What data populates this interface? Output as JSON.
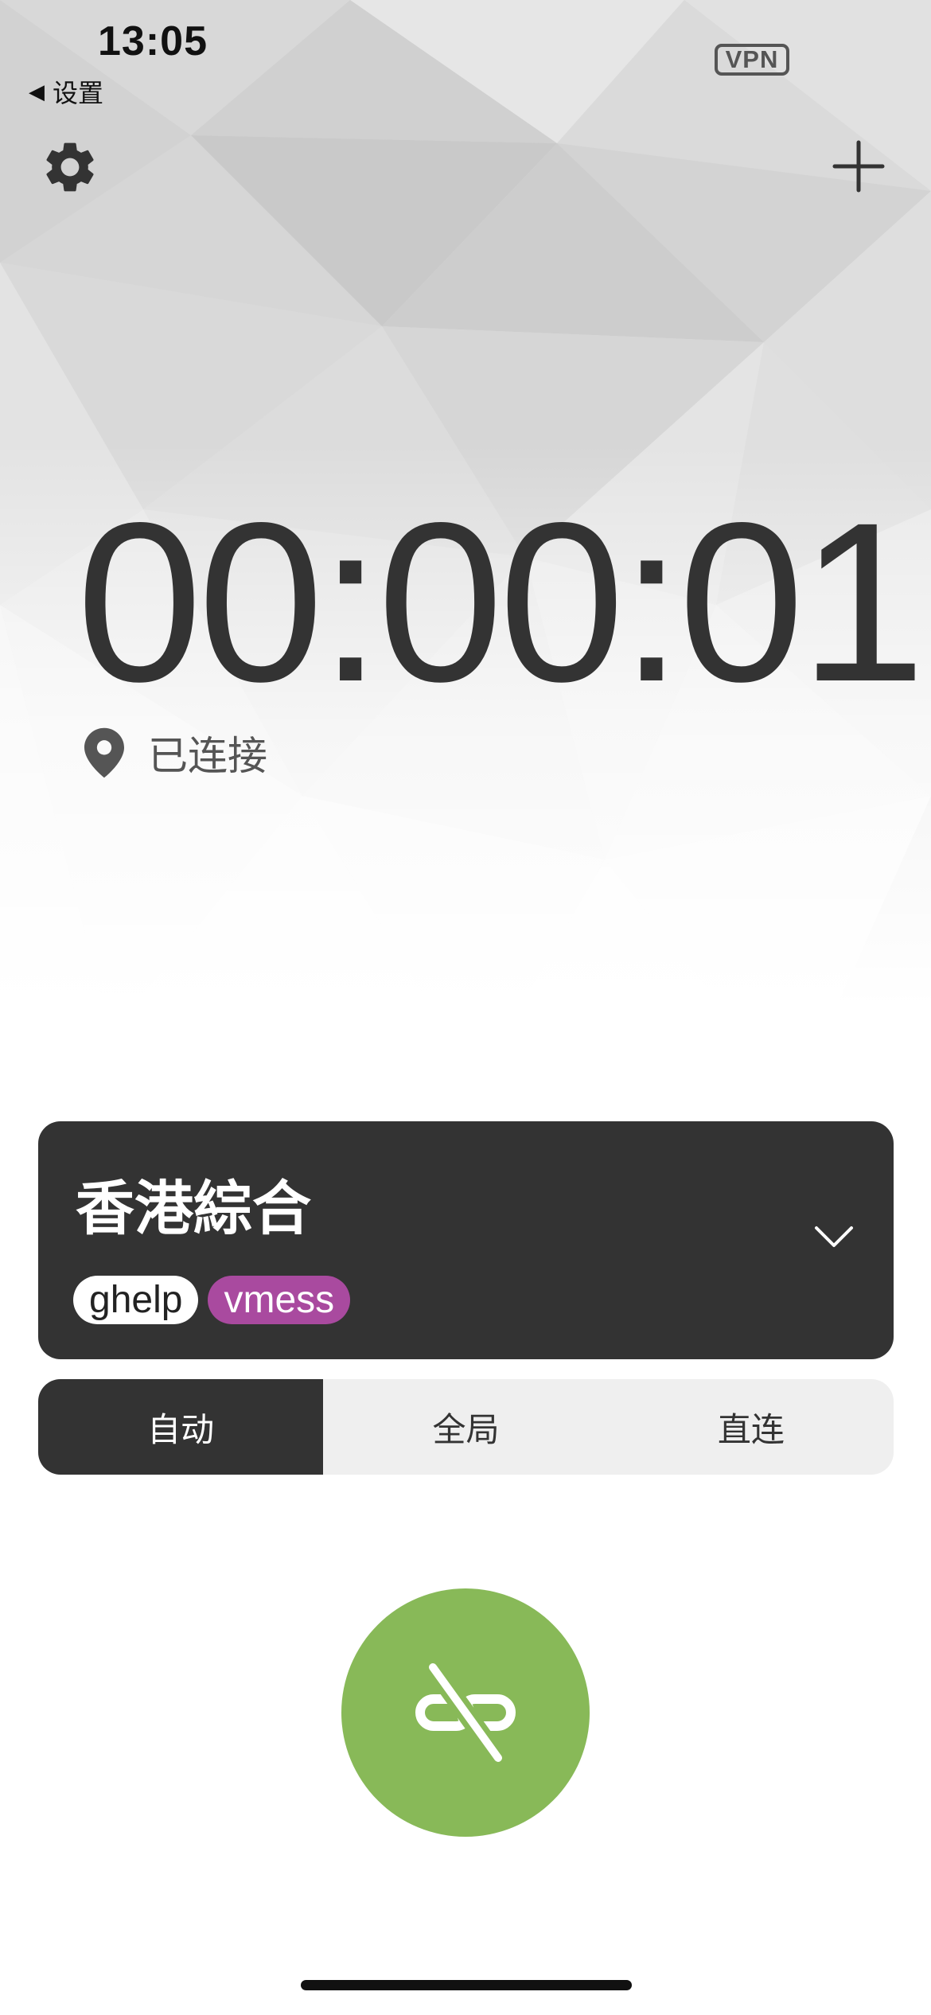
{
  "status_bar": {
    "time": "13:05",
    "back_label": "设置",
    "vpn_label": "VPN"
  },
  "header": {
    "settings_icon": "gear-icon",
    "add_icon": "plus-icon"
  },
  "connection": {
    "timer": "00:00:01",
    "status": "已连接",
    "status_icon": "location-pin-icon"
  },
  "server": {
    "name": "香港綜合",
    "tags": [
      "ghelp",
      "vmess"
    ],
    "expand_icon": "chevron-down-icon"
  },
  "mode": {
    "options": [
      "自动",
      "全局",
      "直连"
    ],
    "selected": "自动"
  },
  "connect_button": {
    "icon": "link-off-icon"
  },
  "colors": {
    "dark": "#333333",
    "accent_green": "#88b958",
    "tag_vmess": "#a94a9f",
    "segment_bg": "#efefef"
  }
}
